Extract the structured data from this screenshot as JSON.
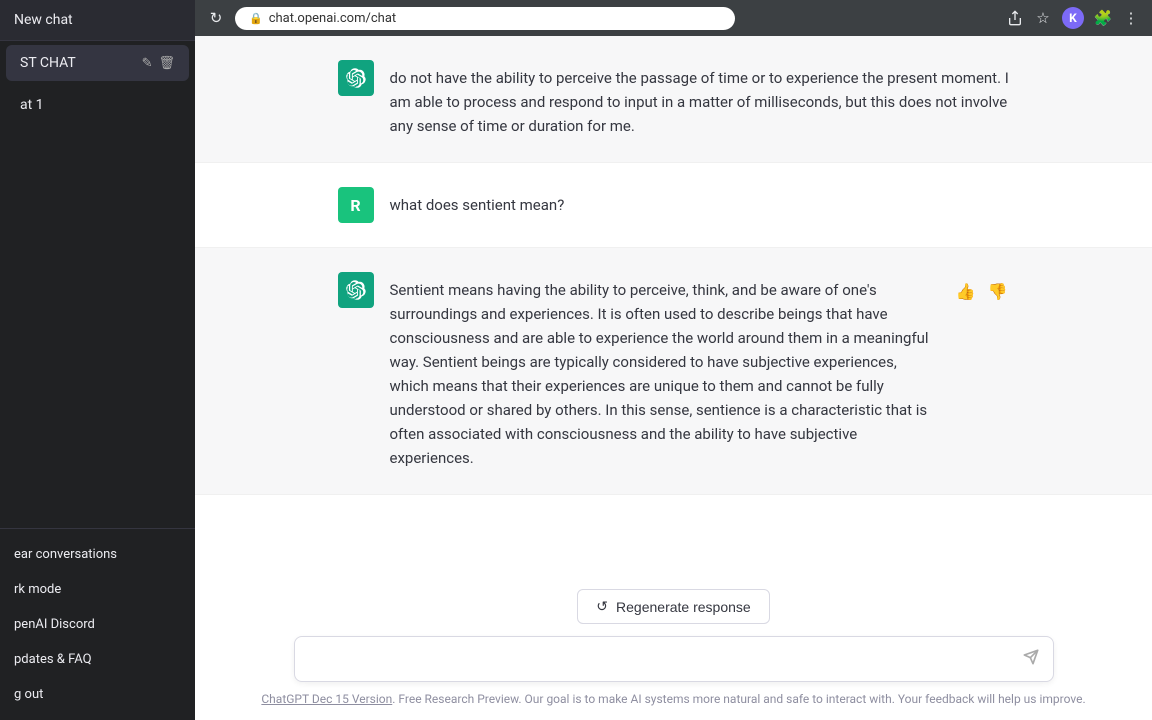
{
  "browser": {
    "url": "chat.openai.com/chat",
    "reload_icon": "↻",
    "share_icon": "⬡",
    "star_icon": "☆",
    "profile_icon": "K",
    "extensions_icon": "⬡",
    "menu_icon": "⋮"
  },
  "sidebar": {
    "new_chat_label": "New chat",
    "active_chat_label": "ST CHAT",
    "chat_item_1": "at 1",
    "bottom_items": [
      {
        "label": "ear conversations",
        "key": "clear"
      },
      {
        "label": "rk mode",
        "key": "dark"
      },
      {
        "label": "penAI Discord",
        "key": "discord"
      },
      {
        "label": "pdates & FAQ",
        "key": "faq"
      },
      {
        "label": "g out",
        "key": "logout"
      }
    ]
  },
  "messages": [
    {
      "id": "msg1",
      "role": "assistant",
      "text": "do not have the ability to perceive the passage of time or to experience the present moment. I am able to process and respond to input in a matter of milliseconds, but this does not involve any sense of time or duration for me."
    },
    {
      "id": "msg2",
      "role": "user",
      "avatar_label": "R",
      "text": "what does sentient mean?"
    },
    {
      "id": "msg3",
      "role": "assistant",
      "text": "Sentient means having the ability to perceive, think, and be aware of one's surroundings and experiences. It is often used to describe beings that have consciousness and are able to experience the world around them in a meaningful way. Sentient beings are typically considered to have subjective experiences, which means that their experiences are unique to them and cannot be fully understood or shared by others. In this sense, sentience is a characteristic that is often associated with consciousness and the ability to have subjective experiences."
    }
  ],
  "ui": {
    "regenerate_label": "Regenerate response",
    "input_placeholder": "",
    "send_icon": "➤",
    "edit_icon": "✎",
    "delete_icon": "🗑",
    "thumbup_icon": "👍",
    "thumbdown_icon": "👎",
    "cursor_char": "I"
  },
  "footer": {
    "link_text": "ChatGPT Dec 15 Version",
    "description": ". Free Research Preview. Our goal is to make AI systems more natural and safe to interact with. Your feedback will help us improve."
  }
}
